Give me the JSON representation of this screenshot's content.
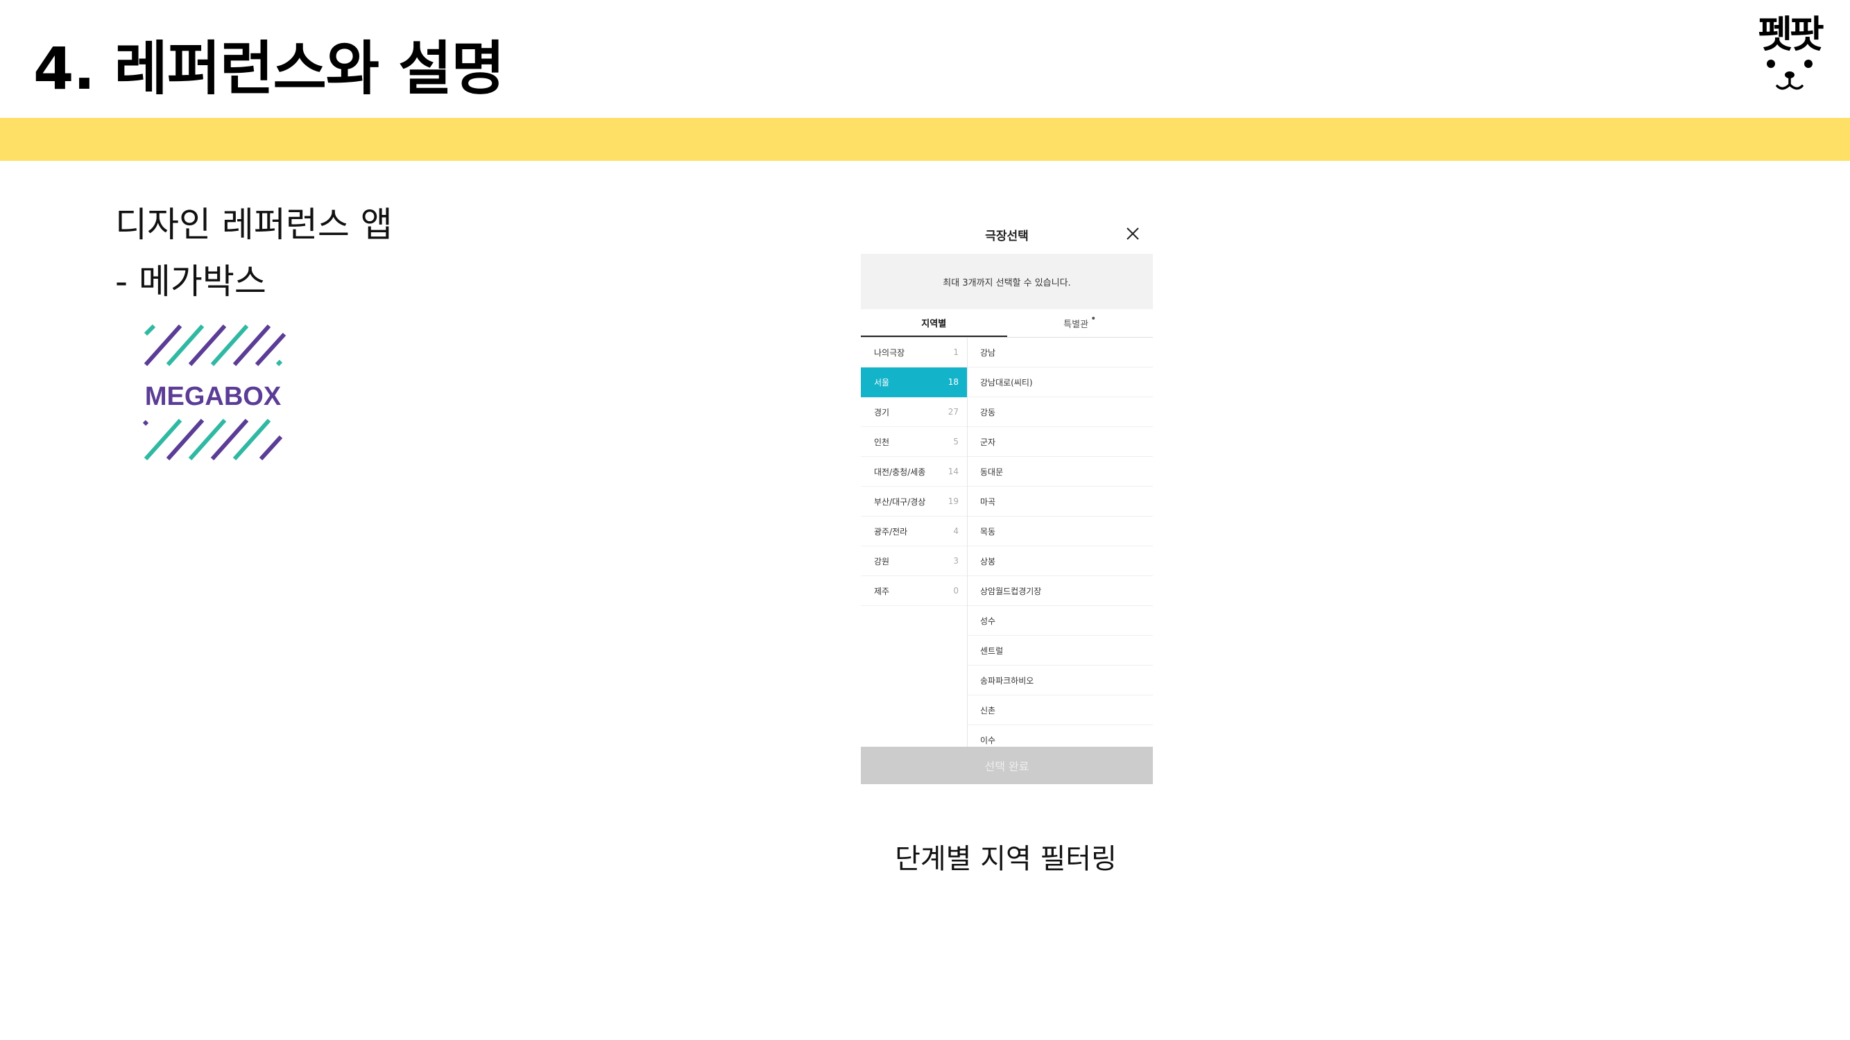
{
  "slide": {
    "title": "4. 레퍼런스와 설명",
    "logo_text": "펫팟",
    "accent_color": "#ffe066"
  },
  "reference": {
    "title": "디자인 레퍼런스 앱",
    "subtitle": "- 메가박스",
    "brand_logo_text": "MEGABOX",
    "brand_colors": [
      "#5b3c96",
      "#2fb9a3"
    ]
  },
  "phone": {
    "header_title": "극장선택",
    "close_icon": "close-icon",
    "notice": "최대 3개까지 선택할 수 있습니다.",
    "tabs": [
      {
        "label": "지역별",
        "active": true
      },
      {
        "label": "특별관",
        "active": false
      }
    ],
    "regions": [
      {
        "name": "나의극장",
        "count": "1"
      },
      {
        "name": "서울",
        "count": "18",
        "selected": true
      },
      {
        "name": "경기",
        "count": "27"
      },
      {
        "name": "인천",
        "count": "5"
      },
      {
        "name": "대전/충청/세종",
        "count": "14"
      },
      {
        "name": "부산/대구/경상",
        "count": "19"
      },
      {
        "name": "광주/전라",
        "count": "4"
      },
      {
        "name": "강원",
        "count": "3"
      },
      {
        "name": "제주",
        "count": "0"
      }
    ],
    "theaters": [
      "강남",
      "강남대로(씨티)",
      "강동",
      "군자",
      "동대문",
      "마곡",
      "목동",
      "상봉",
      "상암월드컵경기장",
      "성수",
      "센트럴",
      "송파파크하비오",
      "신촌",
      "이수"
    ],
    "confirm_label": "선택 완료",
    "selected_color": "#13b3c9"
  },
  "caption": "단계별 지역 필터링"
}
